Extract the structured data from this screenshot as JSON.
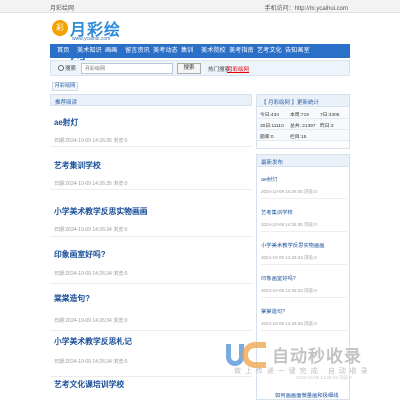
{
  "topbar": {
    "site_name": "月彩绘网",
    "mobile_text": "手机访问：http://m.ycaihui.com"
  },
  "logo": {
    "coin_char": "彩",
    "name": "月彩绘网",
    "url": "www.ycaihui.com"
  },
  "nav": {
    "items": [
      "首页",
      "美术知识",
      "画画",
      "留言资讯",
      "美考动态",
      "集训",
      "美术院校",
      "美考指南",
      "艺考文化",
      "告知画室"
    ]
  },
  "search": {
    "label": "搜索",
    "placeholder": "月彩绘网",
    "button": "搜索",
    "hot_label": "热门搜索：",
    "hot_link": "月彩绘网"
  },
  "breadcrumb": {
    "label": "月彩绘网"
  },
  "main": {
    "heading": "推荐阅读",
    "articles": [
      {
        "title": "ae射灯",
        "meta": "日期:2024-10-09 14:26:35  浏览:0"
      },
      {
        "title": "艺考集训学校",
        "meta": "日期:2024-10-09 14:26:35  浏览:0"
      },
      {
        "title": "小学美术教学反思实物画画",
        "meta": "日期:2024-10-09 14:26:34  浏览:0"
      },
      {
        "title": "印象画室好吗?",
        "meta": "日期:2024-10-09 14:26:34  浏览:0"
      },
      {
        "title": "棠棠造句?",
        "meta": "日期:2024-10-09 14:26:34  浏览:0"
      },
      {
        "title": "小学美术教学反思札记",
        "meta": "日期:2024-10-09 14:26:34  浏览:0"
      },
      {
        "title": "艺考文化课培训学校",
        "meta": ""
      }
    ]
  },
  "sidebar": {
    "stats_title": "【 月彩绘网 】更新统计",
    "stats": {
      "row1": [
        "今日:434",
        "本周:719",
        "7日:4305"
      ],
      "row2": [
        "30日:11110",
        "总共: 21397",
        "昨日:3"
      ],
      "row3": [
        "题库:0",
        "栏目:15"
      ]
    },
    "recent_title": "最新发布",
    "recent": [
      {
        "title": "ae射灯",
        "date": "2024-10-09 14:26:35  浏览:0"
      },
      {
        "title": "艺考集训学校",
        "date": "2024-10-09 14:26:35  浏览:0"
      },
      {
        "title": "小学美术教学反思实物画画",
        "date": "2024-10-09 14:26:34  浏览:0"
      },
      {
        "title": "印象画室好吗?",
        "date": "2024-10-09 14:26:34  浏览:0"
      },
      {
        "title": "棠棠造句?",
        "date": "2024-10-09 14:26:34  浏览:0"
      },
      {
        "title": "如何画画面微量画和极细线",
        "date": ""
      }
    ]
  },
  "watermark": {
    "big": "自动秒收录",
    "small": "做 上 传 递  一 键 完 成 ·  自 动 收 录",
    "tiny": "2024-10-09 14:26:34  浏览:0"
  }
}
